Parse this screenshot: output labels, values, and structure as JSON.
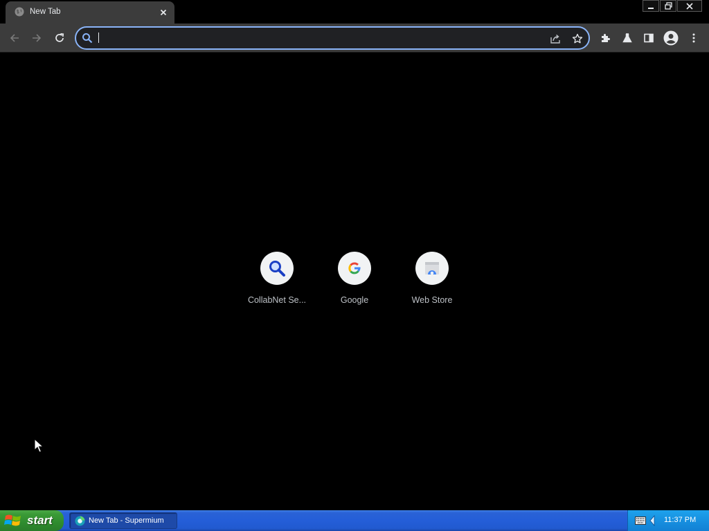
{
  "browser": {
    "tab": {
      "title": "New Tab",
      "close_glyph": "✕"
    },
    "window_controls": {
      "minimize": "minimize",
      "restore": "restore",
      "close": "close"
    },
    "toolbar": {
      "back": "back-arrow",
      "forward": "forward-arrow",
      "reload": "reload",
      "omnibox": {
        "value": "",
        "placeholder": ""
      },
      "right_icons": [
        "extensions-icon",
        "labs-flask-icon",
        "side-panel-icon",
        "profile-avatar-icon",
        "menu-dots-icon"
      ]
    }
  },
  "new_tab": {
    "shortcuts": [
      {
        "label": "CollabNet Se...",
        "icon": "magnifier-icon"
      },
      {
        "label": "Google",
        "icon": "google-g-icon"
      },
      {
        "label": "Web Store",
        "icon": "web-store-icon"
      }
    ]
  },
  "taskbar": {
    "start_label": "start",
    "task_button_label": "New Tab - Supermium",
    "clock": "11:37 PM"
  },
  "colors": {
    "page_bg": "#000000",
    "toolbar_bg": "#3c3c3c",
    "omnibox_border": "#8ab4f8",
    "taskbar_blue": "#245ed8",
    "start_green": "#3a9a36"
  }
}
